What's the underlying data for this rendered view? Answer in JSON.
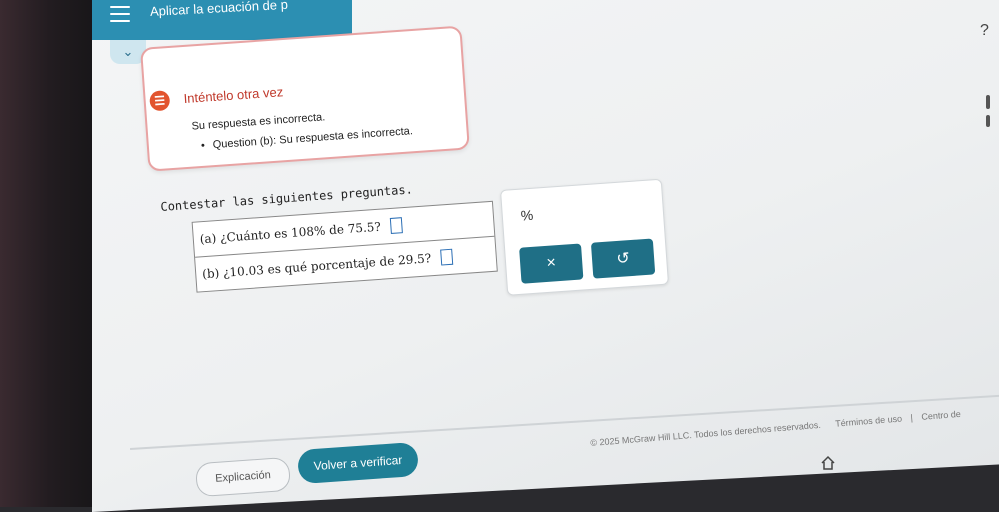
{
  "header": {
    "title": "Aplicar la ecuación de p"
  },
  "alert": {
    "title": "Inténtelo otra vez",
    "message": "Su respuesta es incorrecta.",
    "items": [
      "Question (b): Su respuesta es incorrecta."
    ]
  },
  "problem": {
    "prompt": "Contestar las siguientes preguntas.",
    "questions": [
      {
        "label": "(a) ¿Cuánto es 108% de 75.5?"
      },
      {
        "label": "(b) ¿10.03 es qué porcentaje de 29.5?"
      }
    ]
  },
  "keypad": {
    "percent_label": "%",
    "clear_label": "×",
    "undo_label": "↺"
  },
  "actions": {
    "explanation_label": "Explicación",
    "verify_label": "Volver a verificar"
  },
  "footer": {
    "copyright": "© 2025 McGraw Hill LLC. Todos los derechos reservados.",
    "terms": "Términos de uso",
    "separator": "|",
    "help_center": "Centro de"
  },
  "icons": {
    "menu": "menu-icon",
    "chevron": "chevron-down-icon",
    "alert": "alert-icon",
    "home": "home-icon",
    "help": "help-icon"
  },
  "colors": {
    "header_bg": "#2c8fb2",
    "alert_border": "#e8a3a3",
    "alert_icon": "#e2542e",
    "primary_button": "#1f7f96",
    "keypad_button": "#1f6f86"
  }
}
